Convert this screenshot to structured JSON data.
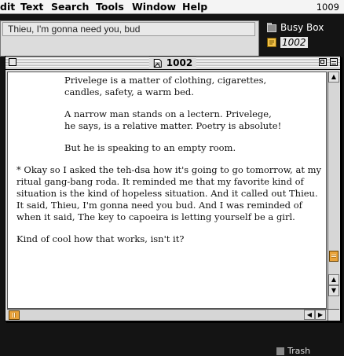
{
  "menubar": {
    "items": [
      "dit",
      "Text",
      "Search",
      "Tools",
      "Window",
      "Help"
    ],
    "clock": "1009"
  },
  "desktop": {
    "items": [
      {
        "label": "Busy Box",
        "icon": "folder-icon"
      },
      {
        "label": "1002",
        "icon": "document-icon",
        "selected": true
      }
    ],
    "bottom_label": "Trash"
  },
  "background_window": {
    "field_value": "Thieu, I'm gonna need you, bud"
  },
  "window": {
    "title": "1002",
    "paragraphs": [
      {
        "poem": true,
        "lines": [
          "Privelege is a matter of clothing, cigarettes,",
          "candles, safety, a warm bed."
        ]
      },
      {
        "poem": true,
        "lines": [
          "A narrow man stands on a lectern. Privelege,",
          "he says, is a relative matter. Poetry is absolute!"
        ]
      },
      {
        "poem": true,
        "lines": [
          "But he is speaking to an empty room."
        ]
      },
      {
        "poem": false,
        "lines": [
          "*  Okay so I asked the teh-dsa how it's going to go tomorrow, at my ritual gang-bang roda. It reminded me that my favorite kind of situation is the kind of hopeless situation. And it called out Thieu. It said, Thieu, I'm gonna need you bud. And I was reminded of when it said, The key to capoeira is letting yourself be a girl."
        ]
      },
      {
        "poem": false,
        "lines": [
          "Kind of cool how that works, isn't it?"
        ]
      }
    ]
  },
  "colors": {
    "scroll_thumb": "#e8a23a",
    "desktop": "#141414"
  }
}
